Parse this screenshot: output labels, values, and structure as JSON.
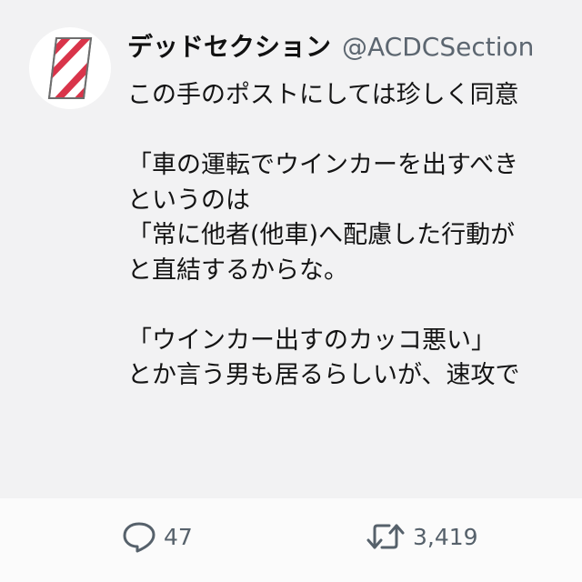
{
  "post": {
    "author_name": "デッドセクション",
    "author_handle": "@ACDCSection",
    "lines": [
      "この手のポストにしては珍しく同意",
      "",
      "「車の運転でウインカーを出すべき",
      "というのは",
      "「常に他者(他車)へ配慮した行動が",
      "と直結するからな。",
      "",
      "「ウインカー出すのカッコ悪い」",
      "とか言う男も居るらしいが、速攻で"
    ]
  },
  "actions": {
    "reply_count": "47",
    "retweet_count": "3,419"
  },
  "icons": {
    "reply": "speech-bubble-icon",
    "retweet": "retweet-arrows-icon",
    "avatar": "red-white-striped-diamond-logo"
  },
  "colors": {
    "background": "#f2f2f3",
    "text": "#141414",
    "secondary": "#5c6670",
    "logo_red": "#d9344a"
  }
}
